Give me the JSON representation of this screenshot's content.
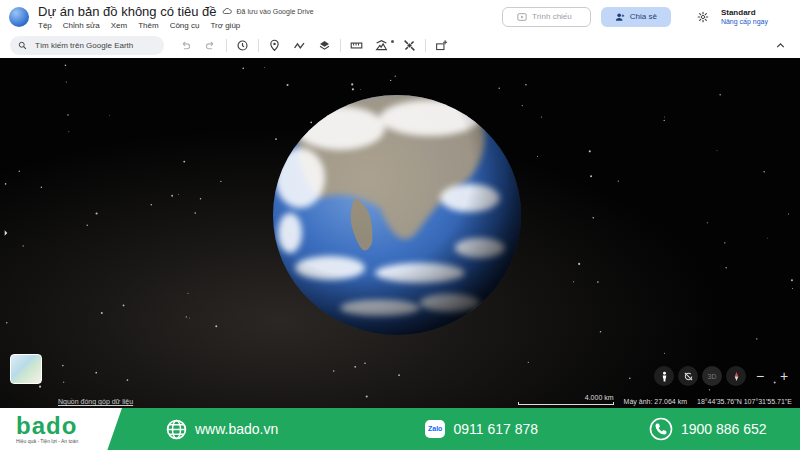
{
  "app": {
    "title": "Dự án bản đồ không có tiêu đề",
    "saved": "Đã lưu vào Google Drive"
  },
  "menu": [
    "Tệp",
    "Chỉnh sửa",
    "Xem",
    "Thêm",
    "Công cụ",
    "Trợ giúp"
  ],
  "header_buttons": {
    "present": {
      "label": "Trình chiếu",
      "disabled": true
    },
    "share": {
      "label": "Chia sẻ"
    }
  },
  "account": {
    "plan": "Standard",
    "upgrade": "Nâng cấp ngay"
  },
  "search": {
    "placeholder": "Tìm kiếm trên Google Earth"
  },
  "history": {
    "undo": {
      "disabled": true
    },
    "redo": {
      "disabled": true
    }
  },
  "map": {
    "attribution": "Nguồn đóng góp dữ liệu",
    "scale": "4.000 km",
    "camera": "Máy ảnh: 27.064 km",
    "coords": "18°44'35.76\"N 107°31'55.71\"E"
  },
  "view_controls": {
    "mode": {
      "label": "3D",
      "active": false
    },
    "zoom_out": "−",
    "zoom_in": "+"
  },
  "footer": {
    "brand": "bado",
    "tagline": "Hiệu quả - Tiện lợi - An toàn",
    "links": [
      {
        "kind": "web",
        "label": "www.bado.vn"
      },
      {
        "kind": "zalo",
        "badge": "Zalo",
        "label": "0911 617 878"
      },
      {
        "kind": "phone",
        "label": "1900 886 652"
      }
    ]
  }
}
